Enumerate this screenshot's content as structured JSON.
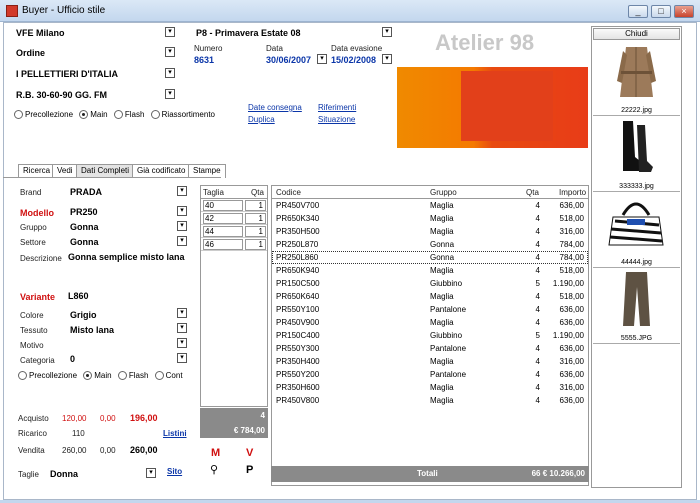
{
  "window": {
    "title": "Buyer - Ufficio stile"
  },
  "header": {
    "supplier": "VFE Milano",
    "order_type": "Ordine",
    "brand_company": "I PELLETTIERI D'ITALIA",
    "payment": "R.B. 30-60-90 GG. FM",
    "season": "P8 - Primavera Estate 08",
    "number_label": "Numero",
    "number": "8631",
    "date_label": "Data",
    "date": "30/06/2007",
    "eval_label": "Data evasione",
    "eval_date": "15/02/2008",
    "atelier": "Atelier 98",
    "links": {
      "delivery": "Date consegna",
      "refs": "Riferimenti",
      "duplicate": "Duplica",
      "situation": "Situazione"
    },
    "radios": [
      "Precollezione",
      "Main",
      "Flash",
      "Riassortimento"
    ]
  },
  "tabs": [
    "Ricerca",
    "Vedi",
    "Dati Completi",
    "Già codificato",
    "Stampe"
  ],
  "form": {
    "brand_label": "Brand",
    "brand": "PRADA",
    "model_label": "Modello",
    "model": "PR250",
    "group_label": "Gruppo",
    "group": "Gonna",
    "sector_label": "Settore",
    "sector": "Gonna",
    "desc_label": "Descrizione",
    "desc": "Gonna semplice misto lana",
    "variant_label": "Variante",
    "variant": "L860",
    "color_label": "Colore",
    "color": "Grigio",
    "fabric_label": "Tessuto",
    "fabric": "Misto lana",
    "motif_label": "Motivo",
    "motif": "",
    "category_label": "Categoria",
    "category": "0",
    "radios": [
      "Precollezione",
      "Main",
      "Flash",
      "Cont"
    ]
  },
  "prices": {
    "acquisto_label": "Acquisto",
    "acq1": "120,00",
    "acq2": "0,00",
    "acq3": "196,00",
    "ricarico_label": "Ricarico",
    "ricarico": "110",
    "listini": "Listini",
    "vendita_label": "Vendita",
    "ven1": "260,00",
    "ven2": "0,00",
    "ven3": "260,00"
  },
  "sizes_row": {
    "label": "Taglie",
    "value": "Donna",
    "sito": "Sito"
  },
  "size_grid": {
    "headers": [
      "Taglia",
      "Qta"
    ],
    "rows": [
      [
        "40",
        "1"
      ],
      [
        "42",
        "1"
      ],
      [
        "44",
        "1"
      ],
      [
        "46",
        "1"
      ]
    ],
    "total_qty": "4",
    "total_amount": "€ 784,00"
  },
  "action_letters": {
    "m": "M",
    "v": "V",
    "p": "P"
  },
  "main_grid": {
    "headers": [
      "Codice",
      "Gruppo",
      "Qta",
      "Importo"
    ],
    "rows": [
      [
        "PR450V700",
        "Maglia",
        "4",
        "636,00"
      ],
      [
        "PR650K340",
        "Maglia",
        "4",
        "518,00"
      ],
      [
        "PR350H500",
        "Maglia",
        "4",
        "316,00"
      ],
      [
        "PR250L870",
        "Gonna",
        "4",
        "784,00"
      ],
      [
        "PR250L860",
        "Gonna",
        "4",
        "784,00"
      ],
      [
        "PR650K940",
        "Maglia",
        "4",
        "518,00"
      ],
      [
        "PR150C500",
        "Giubbino",
        "5",
        "1.190,00"
      ],
      [
        "PR650K640",
        "Maglia",
        "4",
        "518,00"
      ],
      [
        "PR550Y100",
        "Pantalone",
        "4",
        "636,00"
      ],
      [
        "PR450V900",
        "Maglia",
        "4",
        "636,00"
      ],
      [
        "PR150C400",
        "Giubbino",
        "5",
        "1.190,00"
      ],
      [
        "PR550Y300",
        "Pantalone",
        "4",
        "636,00"
      ],
      [
        "PR350H400",
        "Maglia",
        "4",
        "316,00"
      ],
      [
        "PR550Y200",
        "Pantalone",
        "4",
        "636,00"
      ],
      [
        "PR350H600",
        "Maglia",
        "4",
        "316,00"
      ],
      [
        "PR450V800",
        "Maglia",
        "4",
        "636,00"
      ]
    ],
    "selected_index": 4,
    "totals_label": "Totali",
    "totals_value": "66 € 10.266,00"
  },
  "images": {
    "close_label": "Chiudi",
    "items": [
      {
        "caption": "22222.jpg",
        "icon": "coat-image"
      },
      {
        "caption": "333333.jpg",
        "icon": "boots-image"
      },
      {
        "caption": "44444.jpg",
        "icon": "bag-image"
      },
      {
        "caption": "5555.JPG",
        "icon": "trousers-image"
      }
    ]
  }
}
